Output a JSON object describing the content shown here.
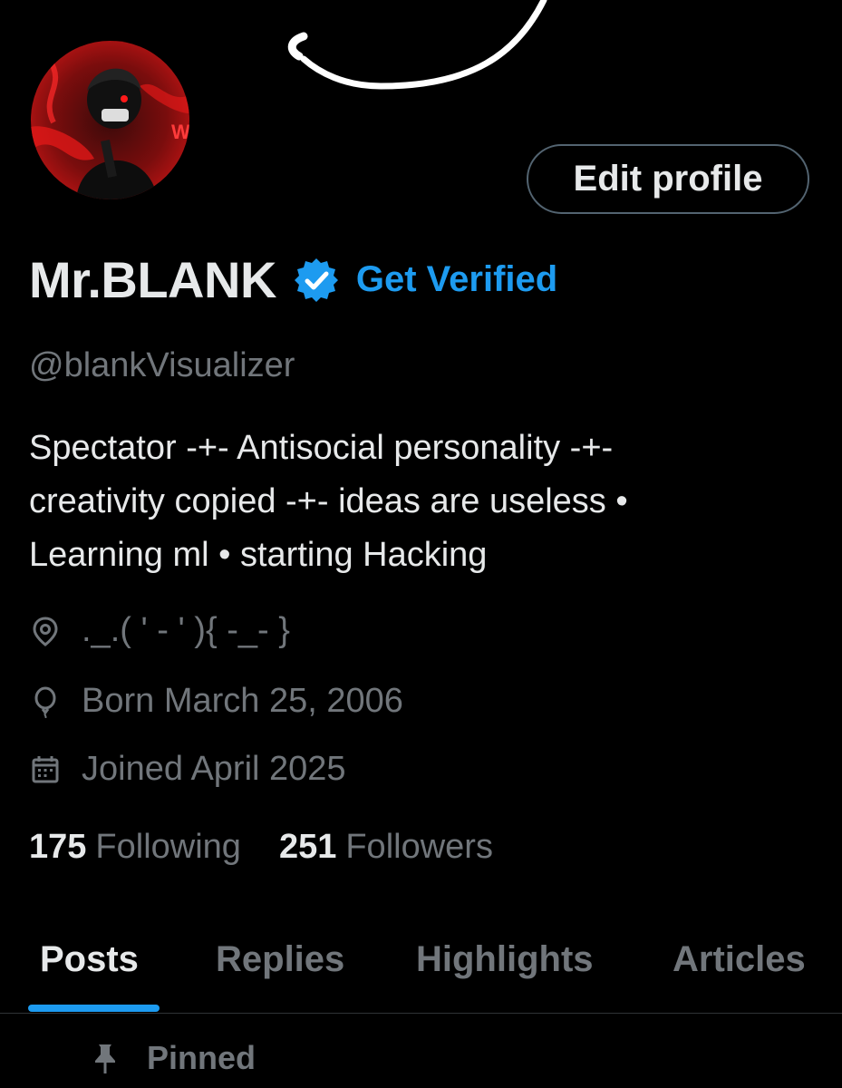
{
  "profile": {
    "name": "Mr.BLANK",
    "get_verified_label": "Get Verified",
    "handle": "@blankVisualizer",
    "bio_lines": [
      "Spectator -+- Antisocial personality -+-",
      "creativity copied -+- ideas are useless •",
      "Learning ml • starting Hacking"
    ],
    "location": "._.( ' - ' ){ -_- }",
    "birthday": "Born March 25, 2006",
    "joined": "Joined April 2025",
    "following_count": "175",
    "following_label": "Following",
    "followers_count": "251",
    "followers_label": "Followers"
  },
  "actions": {
    "edit_profile_label": "Edit profile"
  },
  "tabs": [
    {
      "label": "Posts",
      "active": true
    },
    {
      "label": "Replies",
      "active": false
    },
    {
      "label": "Highlights",
      "active": false
    },
    {
      "label": "Articles",
      "active": false
    }
  ],
  "pinned_label": "Pinned",
  "icons": {
    "verified": "verified-badge-icon",
    "location": "location-pin-icon",
    "birthday": "balloon-icon",
    "joined": "calendar-icon",
    "pinned": "pushpin-icon"
  },
  "colors": {
    "accent": "#1d9bf0",
    "background": "#000000",
    "text": "#e7e9ea",
    "muted": "#71767b"
  }
}
